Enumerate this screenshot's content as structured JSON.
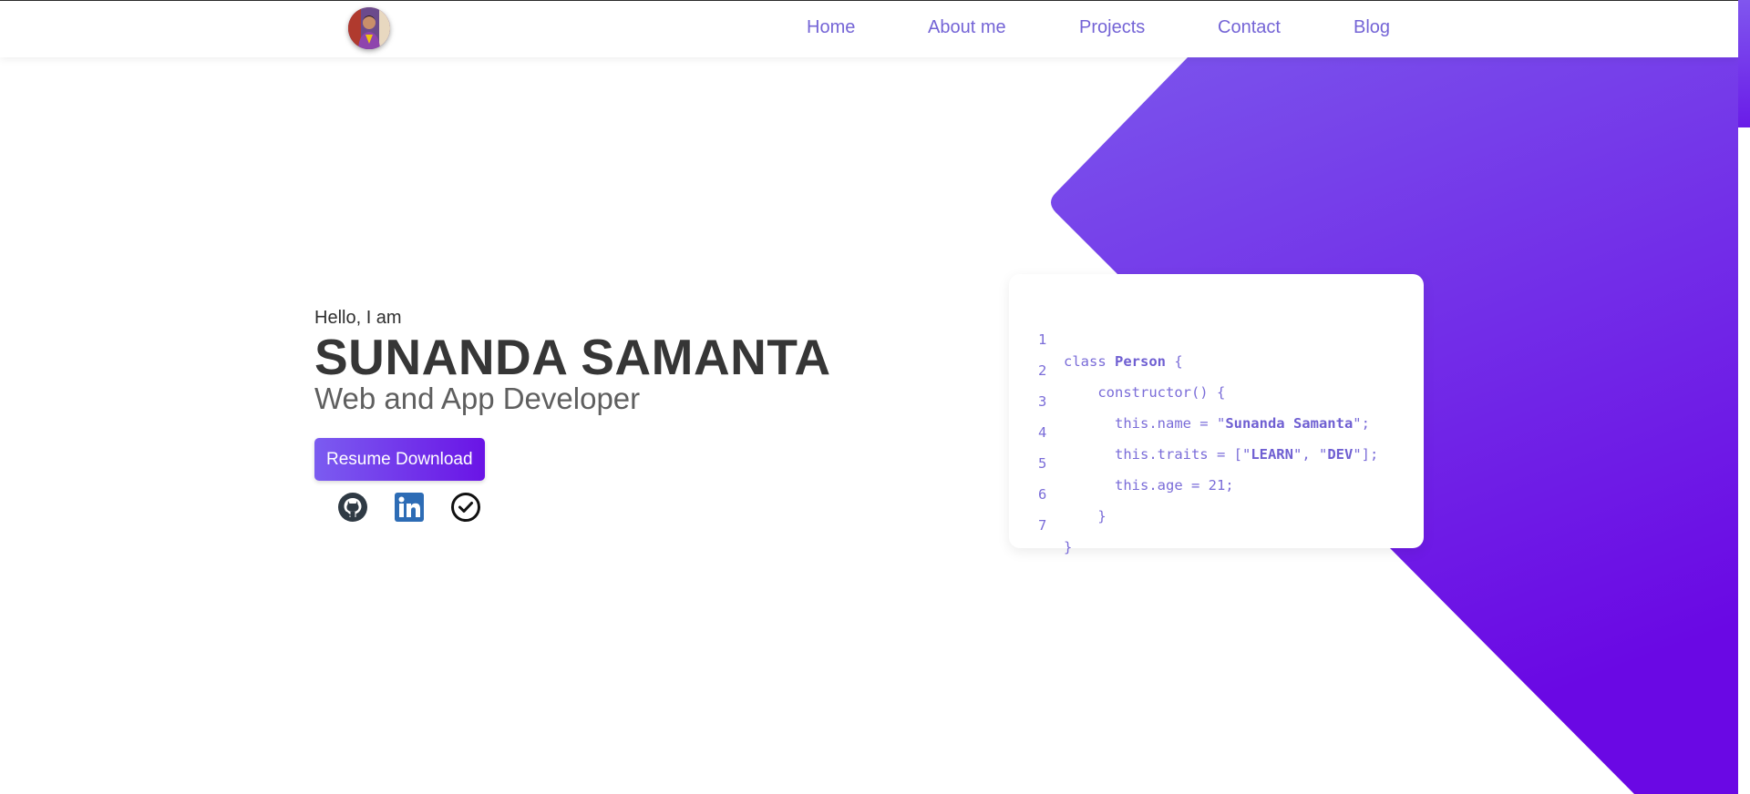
{
  "nav": {
    "items": [
      {
        "label": "Home"
      },
      {
        "label": "About me"
      },
      {
        "label": "Projects"
      },
      {
        "label": "Contact"
      },
      {
        "label": "Blog"
      }
    ]
  },
  "hero": {
    "greeting": "Hello, I am",
    "name": "SUNANDA SAMANTA",
    "role": "Web and App Developer",
    "resume_button": "Resume Download",
    "socials": [
      {
        "icon": "github-icon"
      },
      {
        "icon": "linkedin-icon"
      },
      {
        "icon": "check-circle-icon"
      }
    ]
  },
  "code_card": {
    "lines": [
      {
        "num": "1",
        "text": "class ",
        "bold": "Person",
        "after": " {"
      },
      {
        "num": "2",
        "text": "    constructor() {",
        "bold": "",
        "after": ""
      },
      {
        "num": "3",
        "text": "      this.name = \"",
        "bold": "Sunanda Samanta",
        "after": "\";"
      },
      {
        "num": "4",
        "text": "      this.traits = [\"",
        "bold": "LEARN",
        "after": "\", \"",
        "bold2": "DEV",
        "after2": "\"];"
      },
      {
        "num": "5",
        "text": "      this.age = 21;",
        "bold": "",
        "after": ""
      },
      {
        "num": "6",
        "text": "    }",
        "bold": "",
        "after": ""
      },
      {
        "num": "7",
        "text": "}",
        "bold": "",
        "after": ""
      }
    ]
  },
  "colors": {
    "accent": "#7464d6",
    "purple_light": "#7b5cf0",
    "purple_dark": "#6a14e6",
    "heading": "#363636"
  }
}
